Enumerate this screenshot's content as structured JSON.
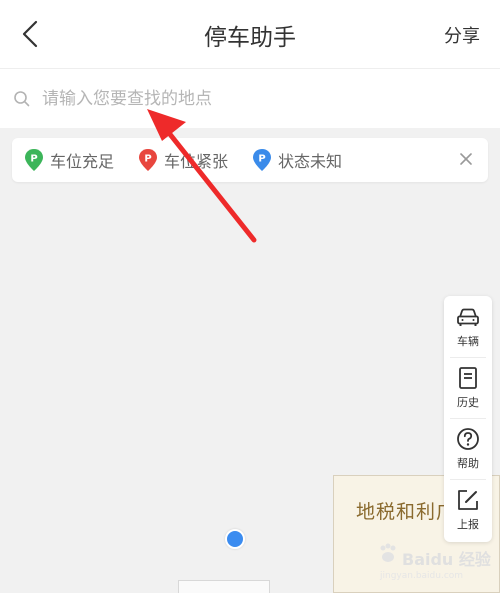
{
  "header": {
    "title": "停车助手",
    "share_label": "分享"
  },
  "search": {
    "placeholder": "请输入您要查找的地点",
    "value": ""
  },
  "legend": {
    "items": [
      {
        "label": "车位充足",
        "color": "#3cb55a",
        "icon": "parking-pin-icon"
      },
      {
        "label": "车位紧张",
        "color": "#e8463e",
        "icon": "parking-pin-icon"
      },
      {
        "label": "状态未知",
        "color": "#3a8bea",
        "icon": "parking-pin-icon"
      }
    ]
  },
  "sidebar": {
    "items": [
      {
        "label": "车辆",
        "icon": "car-icon"
      },
      {
        "label": "历史",
        "icon": "history-icon"
      },
      {
        "label": "帮助",
        "icon": "help-icon"
      },
      {
        "label": "上报",
        "icon": "report-icon"
      }
    ]
  },
  "map": {
    "building_label": "地税和利广"
  },
  "watermark": {
    "text": "Baidu 经验",
    "url": "jingyan.baidu.com"
  },
  "colors": {
    "location_dot": "#3b8cf0",
    "annotation_arrow": "#ee2a2a",
    "map_background": "#f1f1f1"
  }
}
